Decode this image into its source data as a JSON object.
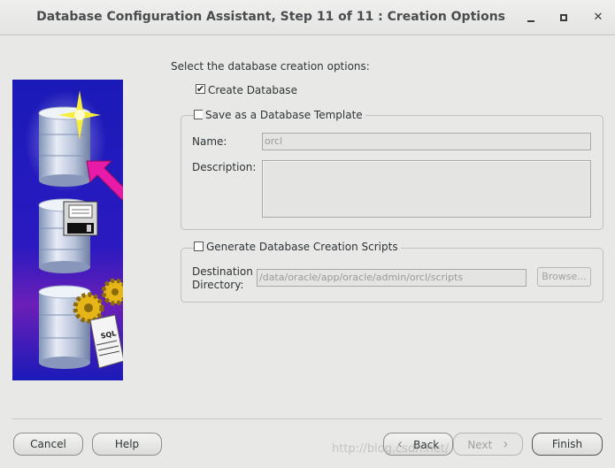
{
  "window": {
    "title": "Database Configuration Assistant, Step 11 of 11 : Creation Options",
    "minimize_label": "_",
    "maximize_label": "□",
    "close_label": "✕"
  },
  "main": {
    "heading": "Select the database creation options:",
    "create_db": {
      "label": "Create Database",
      "checked": true,
      "mark": "✔"
    },
    "template_group": {
      "label": "Save as a Database Template",
      "checked": false,
      "name_label": "Name:",
      "name_value": "orcl",
      "description_label": "Description:",
      "description_value": ""
    },
    "scripts_group": {
      "label": "Generate Database Creation Scripts",
      "checked": false,
      "dest_label_line1": "Destination",
      "dest_label_line2": "Directory:",
      "dest_value": "/data/oracle/app/oracle/admin/orcl/scripts",
      "browse_label": "Browse..."
    }
  },
  "illustration": {
    "sql_text": "SQL"
  },
  "footer": {
    "cancel_label": "Cancel",
    "help_label": "Help",
    "back_label": "Back",
    "back_icon": "‹",
    "next_label": "Next",
    "next_icon": "›",
    "finish_label": "Finish",
    "watermark": "http://blog.csdn.net/"
  },
  "colors": {
    "illustration_blue": "#1a1ab8",
    "illustration_purple": "#6b1fb8",
    "arrow_magenta": "#e81aa8",
    "star_yellow": "#f8ee3a"
  }
}
